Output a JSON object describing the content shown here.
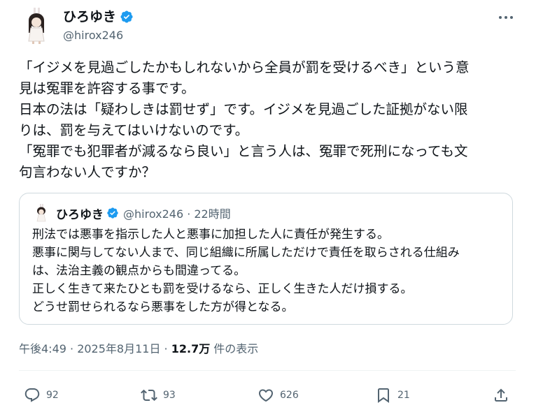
{
  "author": {
    "display_name": "ひろゆき",
    "handle": "@hirox246"
  },
  "tweet": {
    "lines": [
      "「イジメを見過ごしたかもしれないから全員が罰を受けるべき」という意",
      "見は冤罪を許容する事です。",
      "日本の法は「疑わしきは罰せず」です。イジメを見過ごした証拠がない限",
      "りは、罰を与えてはいけないのです。",
      "「冤罪でも犯罪者が減るなら良い」と言う人は、冤罪で死刑になっても文",
      "句言わない人ですか？"
    ]
  },
  "quote": {
    "display_name": "ひろゆき",
    "handle_time": "@hirox246 · 22時間",
    "lines": [
      "刑法では悪事を指示した人と悪事に加担した人に責任が発生する。",
      "悪事に関与してない人まで、同じ組織に所属しただけで責任を取らされる仕組み",
      "は、法治主義の観点からも間違ってる。",
      "正しく生きて来たひとも罰を受けるなら、正しく生きた人だけ損する。",
      "どうせ罰せられるなら悪事をした方が得となる。"
    ]
  },
  "meta": {
    "time_date": "午後4:49 · 2025年8月11日 · ",
    "views_count": "12.7万",
    "views_label": " 件の表示"
  },
  "actions": {
    "replies": "92",
    "retweets": "93",
    "likes": "626",
    "bookmarks": "21"
  },
  "colors": {
    "verified": "#1d9bf0",
    "secondary_text": "#536471",
    "border": "#cfd9de"
  },
  "icons": [
    "avatar",
    "verified-badge-icon",
    "more-icon",
    "reply-icon",
    "retweet-icon",
    "like-icon",
    "bookmark-icon",
    "share-icon"
  ]
}
